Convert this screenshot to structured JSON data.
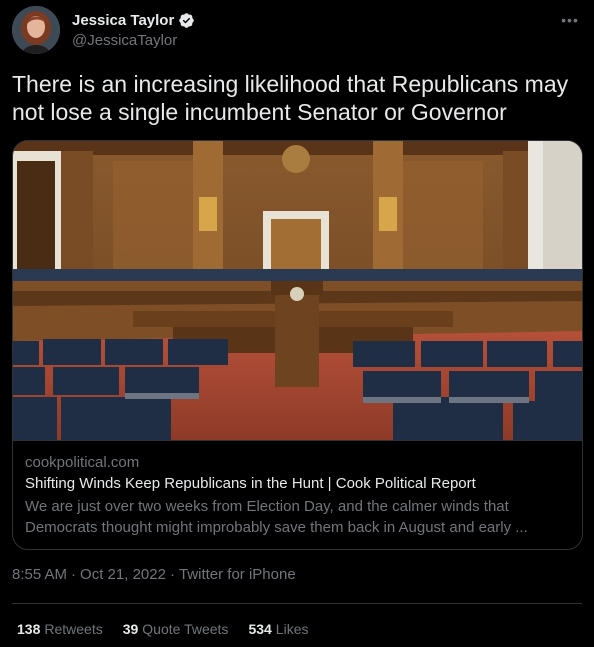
{
  "author": {
    "display_name": "Jessica Taylor",
    "handle": "@JessicaTaylor",
    "verified": true,
    "avatar_icon": "profile-photo"
  },
  "more_icon": "ellipsis-icon",
  "tweet": {
    "text": "There is an increasing likelihood that Republicans may not lose a single incumbent Senator or Governor"
  },
  "card": {
    "image_icon": "senate-hearing-room-photo",
    "domain": "cookpolitical.com",
    "title": "Shifting Winds Keep Republicans in the Hunt | Cook Political Report",
    "description": "We are just over two weeks from Election Day, and the calmer winds that Democrats thought might improbably save them back in August and early ..."
  },
  "meta": {
    "time": "8:55 AM",
    "date": "Oct 21, 2022",
    "separator": "·",
    "source": "Twitter for iPhone"
  },
  "stats": {
    "retweets_count": "138",
    "retweets_label": "Retweets",
    "quotes_count": "39",
    "quotes_label": "Quote Tweets",
    "likes_count": "534",
    "likes_label": "Likes"
  },
  "colors": {
    "background": "#000000",
    "text_primary": "#e7e9ea",
    "text_secondary": "#71767b",
    "border": "#2f3336",
    "verified_badge": "#e7e9ea"
  }
}
